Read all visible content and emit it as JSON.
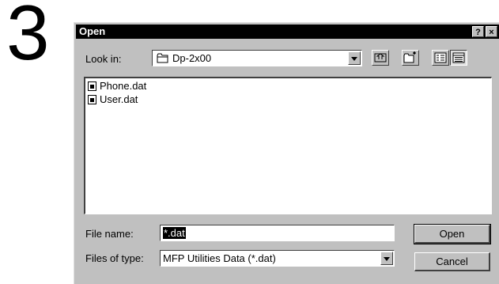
{
  "step": {
    "number": "3"
  },
  "dialog": {
    "title": "Open",
    "help_label": "?",
    "close_label": "×",
    "look_in": {
      "label": "Look in:",
      "value": "Dp-2x00"
    },
    "toolbar": {
      "up_icon": "up-one-level-icon",
      "new_folder_icon": "new-folder-icon",
      "list_icon": "list-view-icon",
      "details_icon": "details-view-icon"
    },
    "files": [
      {
        "name": "Phone.dat"
      },
      {
        "name": "User.dat"
      }
    ],
    "file_name": {
      "label": "File name:",
      "value": "*.dat"
    },
    "file_type": {
      "label": "Files of type:",
      "value": "MFP Utilities Data (*.dat)"
    },
    "open_label": "Open",
    "cancel_label": "Cancel"
  }
}
